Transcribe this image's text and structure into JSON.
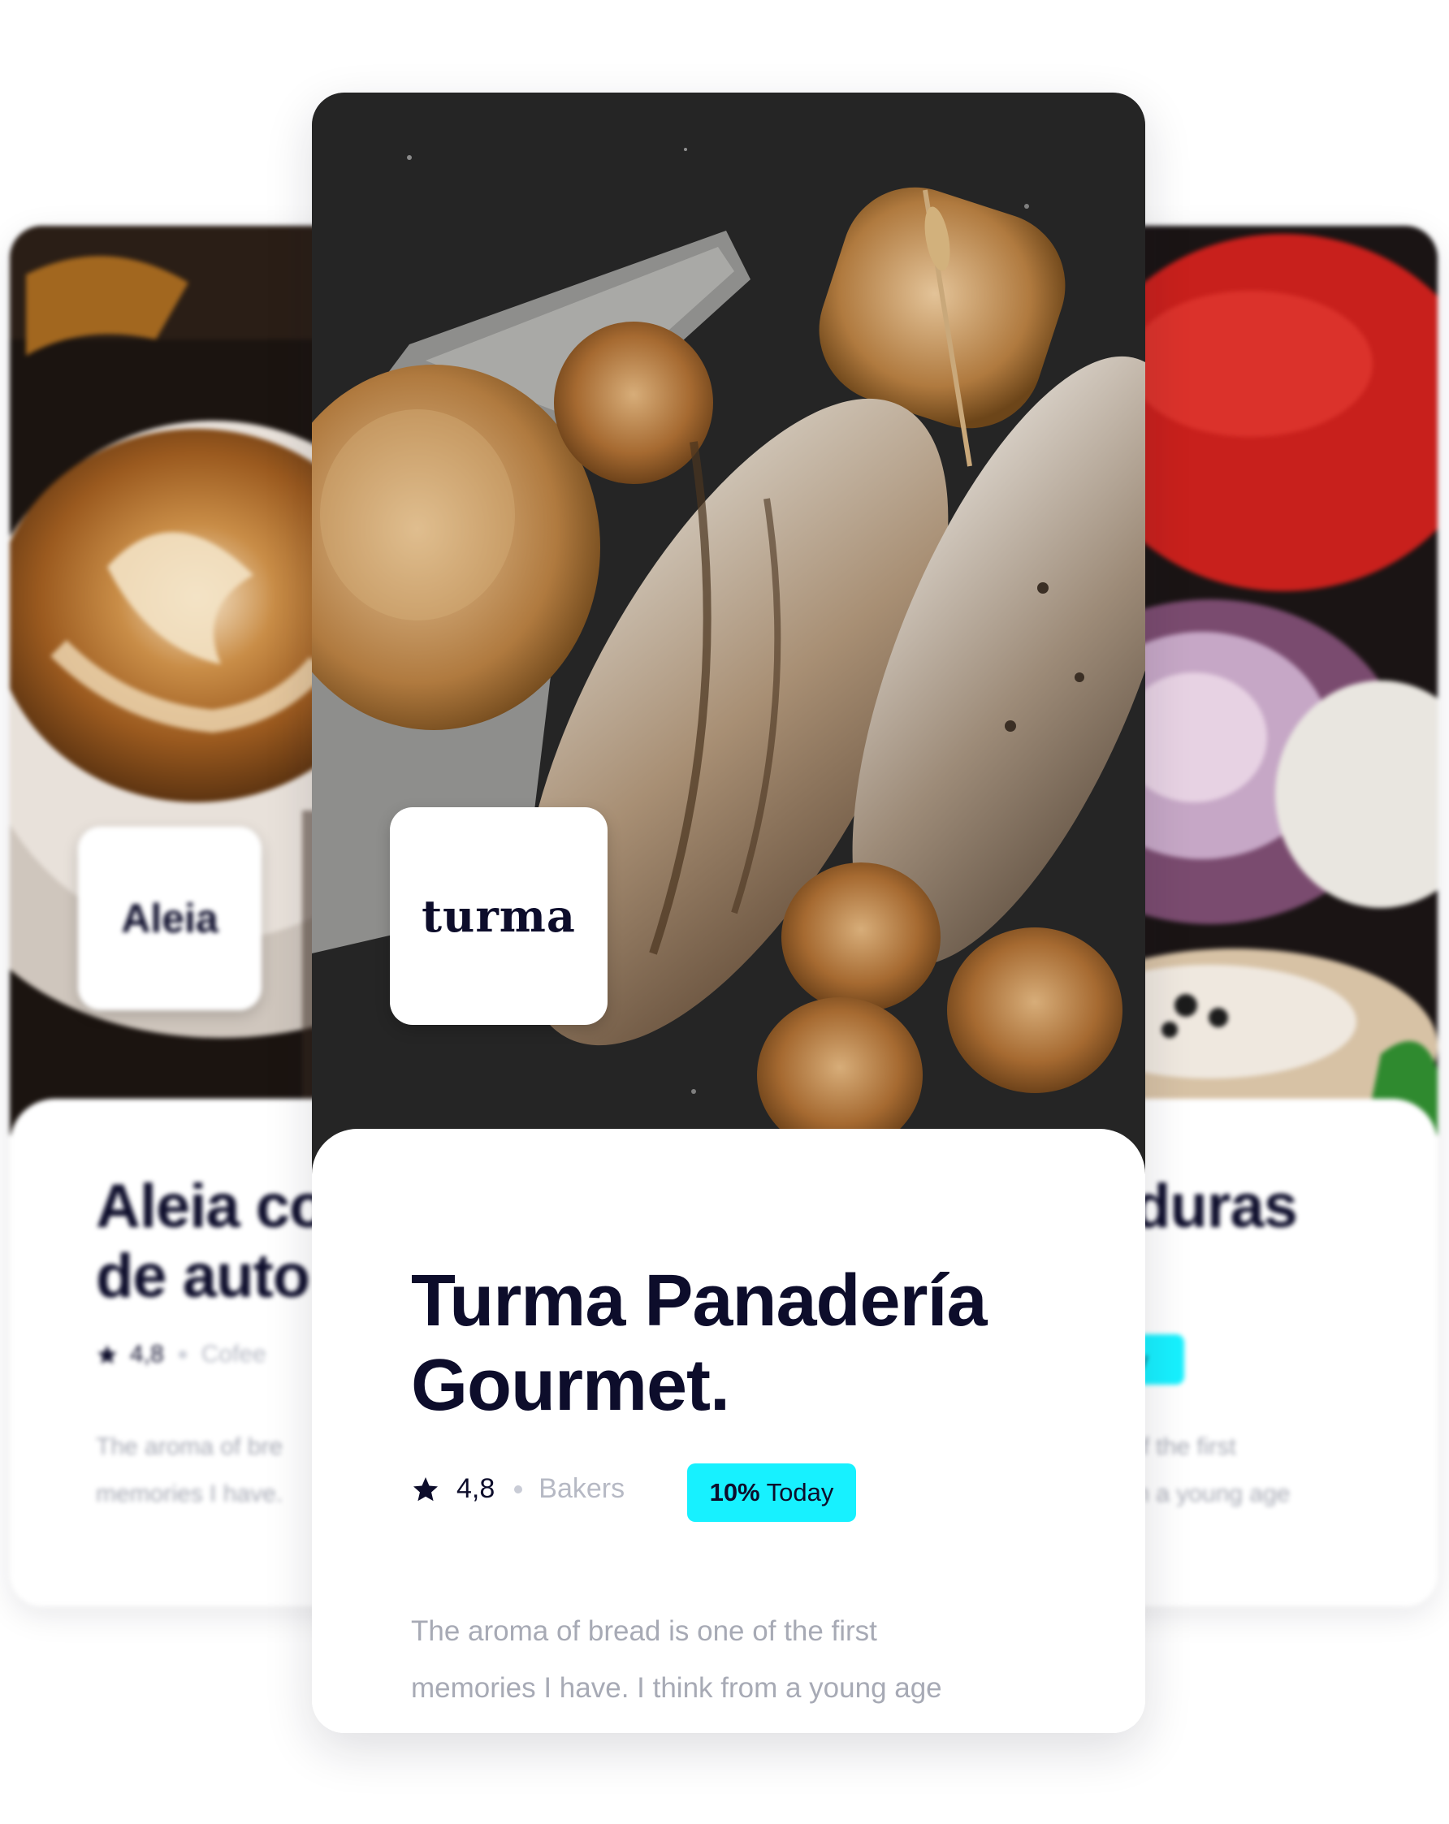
{
  "cards": {
    "left": {
      "logo_text": "Aleia",
      "title_line1": "Aleia co",
      "title_line2": "de auto",
      "rating": "4,8",
      "category": "Cofee",
      "desc_line1": "The aroma of bre",
      "desc_line2": "memories I have."
    },
    "right": {
      "title_line1": "duras",
      "badge": "ay",
      "desc_line1": "of the first",
      "desc_line2": "m a young age"
    },
    "center": {
      "logo_text": "turma",
      "title_line1": "Turma Panadería",
      "title_line2": "Gourmet.",
      "rating": "4,8",
      "category": "Bakers",
      "badge_bold": "10%",
      "badge_rest": " Today",
      "desc_line1": "The aroma of bread is one of the first",
      "desc_line2": "memories I have. I think from a young age"
    }
  },
  "colors": {
    "text_dark": "#0d0d2b",
    "accent_badge": "#17f1ff",
    "muted_text": "#a7aab5"
  }
}
